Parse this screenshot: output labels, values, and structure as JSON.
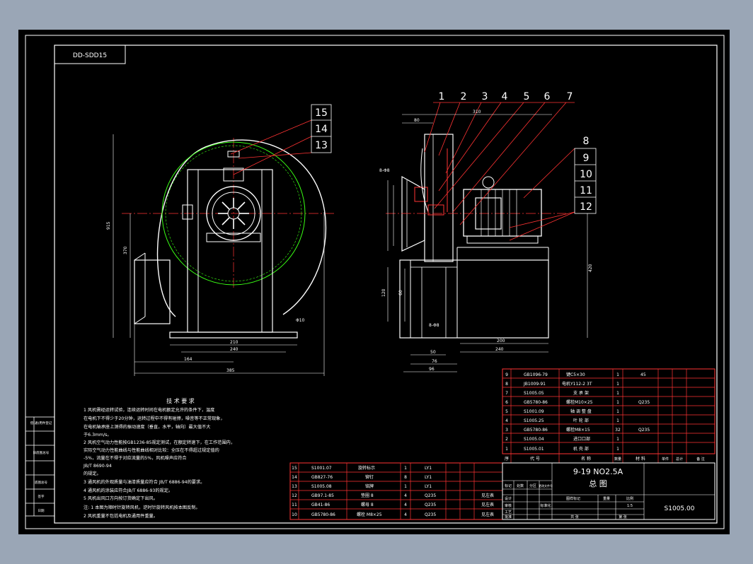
{
  "drawing": {
    "top_code": "DD-SDD15",
    "title_line1": "9-19 NO2.5A",
    "title_line2": "总    图",
    "drawing_number": "S1005.00",
    "sheet": "1",
    "scale": "1:5"
  },
  "balloons": [
    "1",
    "2",
    "3",
    "4",
    "5",
    "6",
    "7",
    "8",
    "9",
    "10",
    "11",
    "12",
    "13",
    "14",
    "15"
  ],
  "dims": {
    "d310": "310",
    "d80": "80",
    "d915": "915",
    "d370": "370",
    "d210": "210",
    "d240": "240",
    "d164": "164",
    "d385": "385",
    "d200": "200",
    "d240b": "240",
    "d50": "50",
    "d76": "76",
    "d96": "96",
    "d120": "120",
    "d60": "60",
    "d420": "420",
    "phi10": "Φ10",
    "phi8": "8-Φ8",
    "phi13": "8-Φ8"
  },
  "tech_notes": {
    "heading": "技  术  要  求",
    "lines": [
      "1 风机需经运转试验，连续运转时间在电机额定允许的条件下，温度",
      "  在电机下不得少于20分钟，运转过程中不得有碰擦，噪音等不正常现象，",
      "  在电机轴承座上测得的振动速度（垂直，水平，轴向）最大值不大",
      "  于6.3mm/s。",
      "2 风机空气动力性能按GB1236-85规定测试，在额定转速下，在工作范围内，",
      "  实际空气动力性能曲线与性能曲线相对比较：全压在不得超过规定值的",
      "  -5%，流量在不得于对应流量的5%，风机噪声应符合",
      "  JB/T 8690-94",
      "  的规定。",
      "3 通风机的外观质量与油漆质量应符合 JB/T 6886-94的要求。",
      "4 通风机的涂装应符合JB/T 6886-93的规定。",
      "5 风机出风口方向按订货确定下出风。",
      "注: 1 本图为顺时针旋转风机，逆时针旋转风机按本图反制。",
      "    2 风机重量不包括电机及通用件重量。"
    ]
  },
  "parts_upper": [
    {
      "no": "9",
      "code": "GB1096-79",
      "name": "键C5×30",
      "qty": "1",
      "mat": "45"
    },
    {
      "no": "8",
      "code": "JB1009-91",
      "name": "电机Y112-2 3T",
      "qty": "1",
      "mat": ""
    },
    {
      "no": "7",
      "code": "S1005.05",
      "name": "支 承 架",
      "qty": "1",
      "mat": ""
    },
    {
      "no": "6",
      "code": "GB5780-86",
      "name": "螺栓M10×25",
      "qty": "1",
      "mat": "Q235"
    },
    {
      "no": "5",
      "code": "S1001.09",
      "name": "轴 调 整 盘",
      "qty": "1",
      "mat": ""
    },
    {
      "no": "4",
      "code": "S1005.25",
      "name": "叶 轮 部",
      "qty": "1",
      "mat": ""
    },
    {
      "no": "3",
      "code": "GB5780-86",
      "name": "螺栓M8×15",
      "qty": "32",
      "mat": "Q235"
    },
    {
      "no": "2",
      "code": "S1005.04",
      "name": "进口口部",
      "qty": "1",
      "mat": ""
    },
    {
      "no": "1",
      "code": "S1005.01",
      "name": "机 壳 部",
      "qty": "1",
      "mat": ""
    }
  ],
  "parts_header": [
    "序",
    "代    号",
    "名    称",
    "数量",
    "材    料",
    "单件",
    "总计",
    "备    注"
  ],
  "parts_lower": [
    {
      "no": "15",
      "code": "S1001.07",
      "name": "旋转标示",
      "qty": "1",
      "mat": "LY1",
      "note": ""
    },
    {
      "no": "14",
      "code": "GB827-76",
      "name": "铆钉",
      "qty": "8",
      "mat": "LY1",
      "note": ""
    },
    {
      "no": "13",
      "code": "S1005.08",
      "name": "铭牌",
      "qty": "1",
      "mat": "LY1",
      "note": ""
    },
    {
      "no": "12",
      "code": "GB97.1-85",
      "name": "垫圈 8",
      "qty": "4",
      "mat": "Q235",
      "note": "见左表"
    },
    {
      "no": "11",
      "code": "GB41-86",
      "name": "螺母 8",
      "qty": "4",
      "mat": "Q235",
      "note": "见左表"
    },
    {
      "no": "10",
      "code": "GB5780-86",
      "name": "螺栓 M8×25",
      "qty": "4",
      "mat": "Q235",
      "note": "见左表"
    }
  ],
  "title_block": {
    "labels": [
      "标记",
      "处数",
      "分区",
      "更改文件号",
      "签名",
      "年月日"
    ],
    "roles": [
      "设计",
      "审核",
      "工艺",
      "批准",
      "标准化"
    ],
    "stage": "图样标记",
    "weight": "重量",
    "ratio": "比例",
    "sheets_total": "共  张",
    "sheet_no": "第  张"
  },
  "side_block": [
    "借(通)用件登记",
    "旧底图总号",
    "底图总号",
    "签字",
    "日期"
  ]
}
